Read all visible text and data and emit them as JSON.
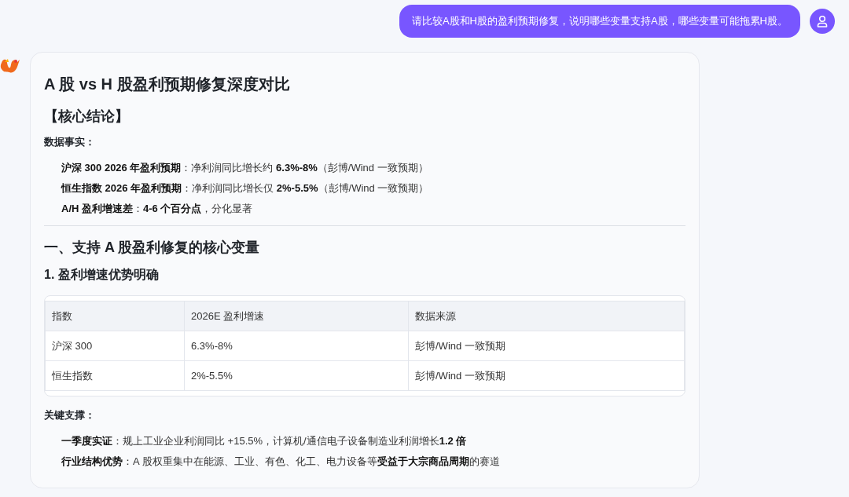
{
  "user_message": {
    "text": "请比较A股和H股的盈利预期修复，说明哪些变量支持A股，哪些变量可能拖累H股。"
  },
  "answer": {
    "blocks": [
      {
        "kind": "title",
        "text": "A 股 vs H 股盈利预期修复深度对比"
      },
      {
        "kind": "heading",
        "text": "【核心结论】"
      },
      {
        "kind": "label",
        "text": "数据事实："
      },
      {
        "kind": "bullet",
        "text": "**沪深 300 2026 年盈利预期**：净利润同比增长约 **6.3%-8%**（彭博/Wind 一致预期）"
      },
      {
        "kind": "bullet",
        "text": "**恒生指数 2026 年盈利预期**：净利润同比增长仅 **2%-5.5%**（彭博/Wind 一致预期）"
      },
      {
        "kind": "bullet",
        "text": "**A/H 盈利增速差**：**4-6 个百分点**，分化显著"
      },
      {
        "kind": "divider"
      },
      {
        "kind": "heading",
        "text": "一、支持 A 股盈利修复的核心变量"
      },
      {
        "kind": "subheading",
        "text": "1. 盈利增速优势明确"
      },
      {
        "kind": "table",
        "columns": [
          "指数",
          "2026E 盈利增速",
          "数据来源"
        ],
        "rows": [
          [
            "沪深 300",
            "6.3%-8%",
            "彭博/Wind 一致预期"
          ],
          [
            "恒生指数",
            "2%-5.5%",
            "彭博/Wind 一致预期"
          ]
        ]
      },
      {
        "kind": "label",
        "text": "关键支撑："
      },
      {
        "kind": "bullet",
        "text": "**一季度实证**：规上工业企业利润同比 +15.5%，计算机/通信电子设备制造业利润增长**1.2 倍**"
      },
      {
        "kind": "bullet",
        "text": "**行业结构优势**：A 股权重集中在能源、工业、有色、化工、电力设备等**受益于大宗商品周期**的赛道"
      }
    ]
  }
}
